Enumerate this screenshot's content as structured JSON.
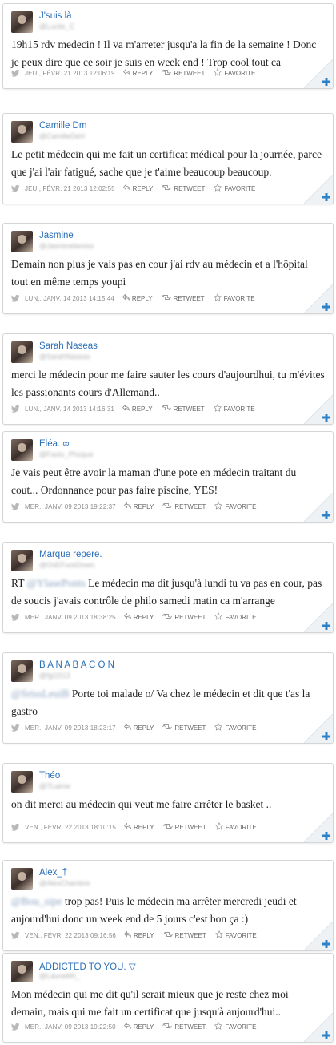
{
  "actions": {
    "reply": "REPLY",
    "retweet": "RETWEET",
    "favorite": "FAVORITE"
  },
  "tweets": [
    {
      "name": "J'suis là",
      "handle": "@Lucile_C",
      "text": "19h15 rdv medecin ! Il va m'arreter jusqu'a la fin de la semaine ! Donc je peux dire que ce soir je suis en week end ! Trop cool tout ca",
      "date": "JEU., FÉVR. 21 2013 12:06:19"
    },
    {
      "name": "Camille Dm",
      "handle": "@CamilleDeH",
      "text": "Le petit médecin qui me fait un certificat médical pour la journée, parce que j'ai l'air fatigué, sache que je t'aime beaucoup beaucoup.",
      "date": "JEU., FÉVR. 21 2013 12:02:55"
    },
    {
      "name": "Jasmine",
      "handle": "@Jasminelamiss",
      "text": "Demain non plus je vais pas en cour j'ai rdv au médecin et a l'hôpital tout en même temps youpi",
      "date": "LUN., JANV. 14 2013 14:15:44"
    },
    {
      "name": "Sarah Naseas",
      "handle": "@SarahNaseas",
      "text": "merci le médecin pour me faire sauter les cours d'aujourdhui, tu m'évites les passionants cours d'Allemand..",
      "date": "LUN., JANV. 14 2013 14:16:31"
    },
    {
      "name": "Eléa. ∞",
      "handle": "@Fasto_Phoque",
      "text": "Je vais peut être avoir la maman d'une pote en médecin traitant du cout... Ordonnance pour pas faire piscine, YES!",
      "date": "MER., JANV. 09 2013 19:22:37"
    },
    {
      "name": "Marque repere.",
      "handle": "@OsEFuckDown",
      "mention": "@YlasePonts",
      "text": "RT ",
      "text_after": "  Le médecin ma dit jusqu'à lundi tu va pas en cour, pas de soucis j'avais contrôle de philo samedi matin ca m'arrange",
      "date": "MER., JANV. 09 2013 18:38:25"
    },
    {
      "name": "B A N A B A C O N",
      "handle": "@fgi1513",
      "mention": "@SrissLeuiB",
      "text": "",
      "text_after": " Porte toi malade o/ Va chez le médecin et dit que t'as la gastro",
      "date": "MER., JANV. 09 2013 18:23:17"
    },
    {
      "name": "Théo",
      "handle": "@TLaime",
      "text": "on dit merci au médecin qui veut me faire arrêter le basket ..",
      "date": "VEN., FÉVR. 22 2013 18:10:15"
    },
    {
      "name": "Alex_†",
      "handle": "@AlexChambre",
      "mention": "@Bou_sipe",
      "text": "",
      "text_after": " trop pas! Puis le médecin ma arrêter mercredi jeudi et aujourd'hui donc un week end de 5 jours c'est bon ça :)",
      "date": "VEN., FÉVR. 22 2013 09:16:56"
    },
    {
      "name": "ADDICTED TO YOU. ▽",
      "handle": "@LauraWh_",
      "text": "Mon médecin qui me dit qu'il serait mieux que je reste chez moi demain, mais qui me fait un certificat que jusqu'à aujourd'hui..",
      "date": "MER., JANV. 09 2013 19:22:50"
    }
  ],
  "icons": {
    "bird": "twitter-bird-icon",
    "reply": "reply-arrow-icon",
    "retweet": "retweet-icon",
    "favorite": "star-icon",
    "corner": "plus-corner-icon"
  },
  "colors": {
    "name": "#2a6fb8",
    "corner": "#2b82c9"
  }
}
